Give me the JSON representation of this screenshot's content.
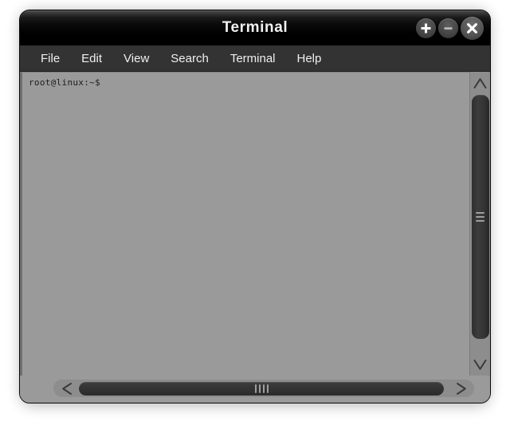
{
  "window": {
    "title": "Terminal",
    "controls": [
      {
        "name": "maximize-button",
        "icon": "plus-icon",
        "label": "+"
      },
      {
        "name": "minimize-button",
        "icon": "minus-icon",
        "label": "−"
      },
      {
        "name": "close-button",
        "icon": "close-icon",
        "label": "×"
      }
    ]
  },
  "menubar": {
    "items": [
      {
        "label": "File"
      },
      {
        "label": "Edit"
      },
      {
        "label": "View"
      },
      {
        "label": "Search"
      },
      {
        "label": "Terminal"
      },
      {
        "label": "Help"
      }
    ]
  },
  "terminal": {
    "lines": [
      "root@linux:~$"
    ],
    "prompt": "root@linux:~$",
    "user": "root",
    "host": "linux",
    "cwd": "~",
    "symbol": "$",
    "background_color": "#9a9a9a",
    "text_color": "#1d1d1d"
  },
  "scrollbars": {
    "vertical": {
      "up_arrow_icon": "chevron-up-icon",
      "down_arrow_icon": "chevron-down-icon",
      "grip_icon": "grip-horizontal-icon"
    },
    "horizontal": {
      "left_arrow_icon": "chevron-left-icon",
      "right_arrow_icon": "chevron-right-icon",
      "grip_icon": "grip-vertical-icon"
    }
  },
  "theme": {
    "titlebar_color": "#000000",
    "menubar_color": "#333333",
    "window_border_color": "#0a0a0a",
    "scrollbar_track_color": "#8d8d8d",
    "scrollbar_thumb_color": "#343434",
    "page_background": "#ffffff"
  }
}
